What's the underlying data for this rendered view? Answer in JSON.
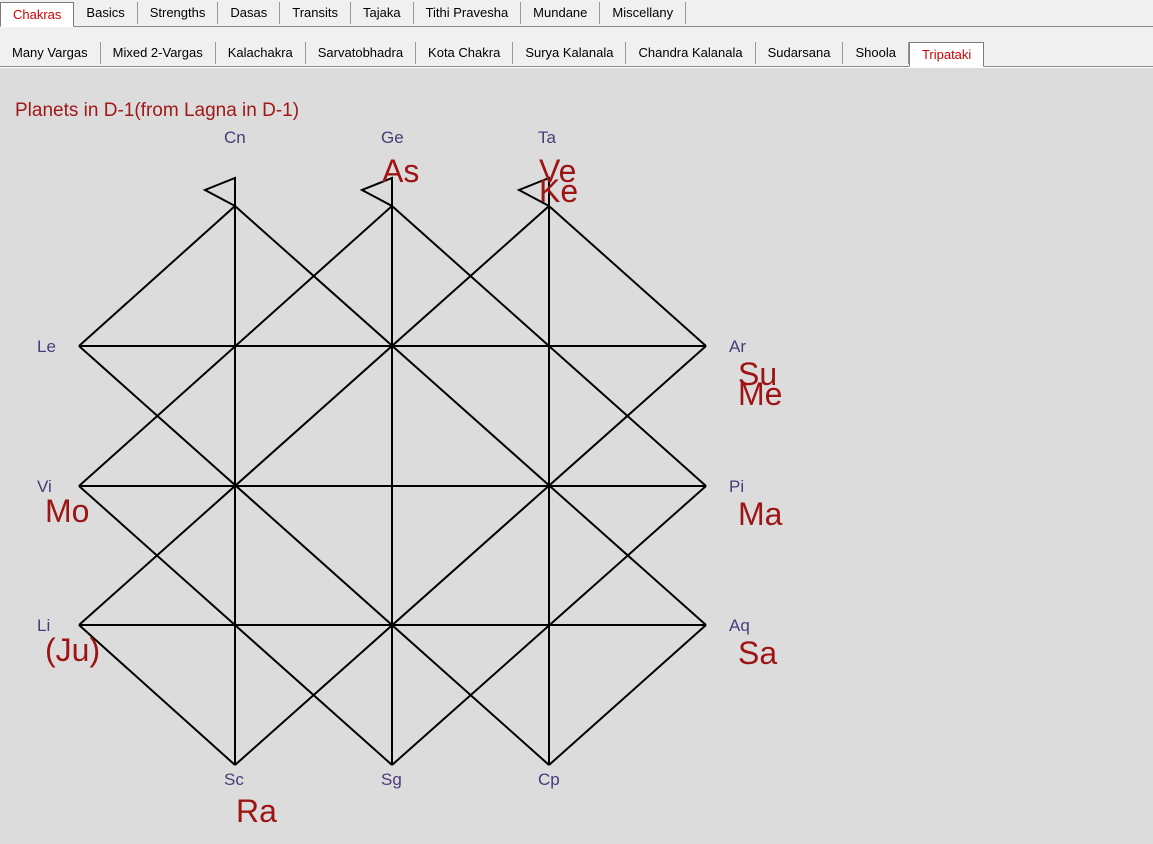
{
  "top_tabs": [
    "Chakras",
    "Basics",
    "Strengths",
    "Dasas",
    "Transits",
    "Tajaka",
    "Tithi Pravesha",
    "Mundane",
    "Miscellany"
  ],
  "top_active": "Chakras",
  "sub_tabs": [
    "Many Vargas",
    "Mixed 2-Vargas",
    "Kalachakra",
    "Sarvatobhadra",
    "Kota Chakra",
    "Surya Kalanala",
    "Chandra Kalanala",
    "Sudarsana",
    "Shoola",
    "Tripataki"
  ],
  "sub_active": "Tripataki",
  "chart": {
    "title": "Planets in D-1(from Lagna in D-1)",
    "signs": {
      "top": [
        "Cn",
        "Ge",
        "Ta"
      ],
      "left": [
        "Le",
        "Vi",
        "Li"
      ],
      "right": [
        "Ar",
        "Pi",
        "Aq"
      ],
      "bottom": [
        "Sc",
        "Sg",
        "Cp"
      ]
    },
    "planets": {
      "Ge": [
        "As"
      ],
      "Ta": [
        "Ve",
        "Ke"
      ],
      "Ar": [
        "Su",
        "Me"
      ],
      "Vi": [
        "Mo"
      ],
      "Pi": [
        "Ma"
      ],
      "Li": [
        "(Ju)"
      ],
      "Aq": [
        "Sa"
      ],
      "Sc": [
        "Ra"
      ]
    }
  }
}
